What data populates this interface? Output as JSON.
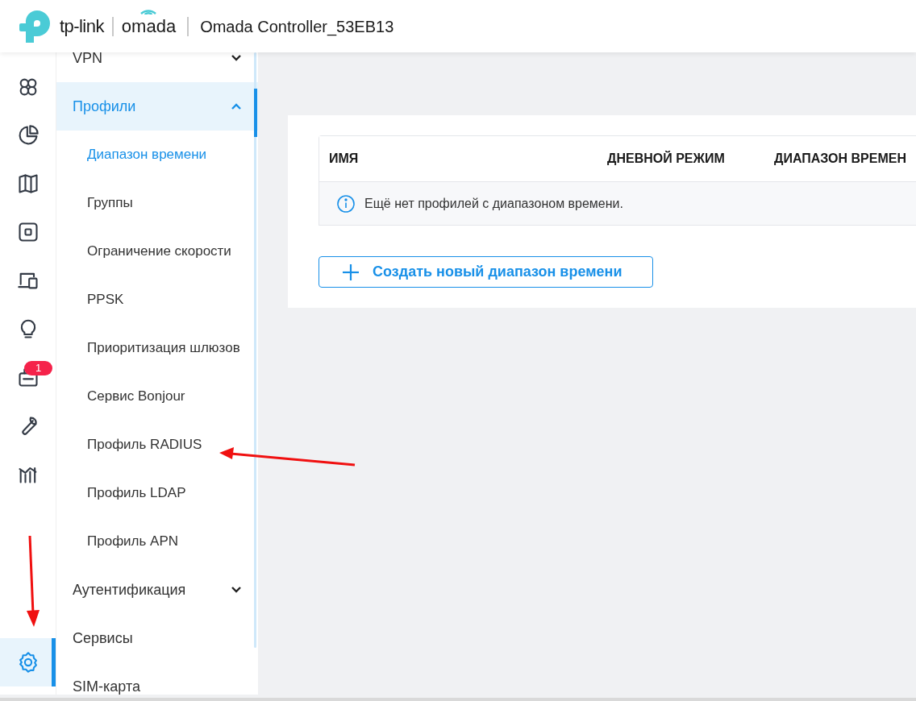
{
  "header": {
    "brand": "tp-link",
    "product": "omada",
    "title": "Omada Controller_53EB13"
  },
  "rail": [
    {
      "kind": "dashboard",
      "selected": false
    },
    {
      "kind": "statistics",
      "selected": false
    },
    {
      "kind": "map",
      "selected": false
    },
    {
      "kind": "devices",
      "selected": false
    },
    {
      "kind": "clients",
      "selected": false
    },
    {
      "kind": "insight",
      "selected": false
    },
    {
      "kind": "log",
      "selected": false,
      "badge": "1"
    },
    {
      "kind": "tools",
      "selected": false
    },
    {
      "kind": "reports",
      "selected": false
    },
    {
      "kind": "settings",
      "selected": true
    }
  ],
  "menu": [
    {
      "label": "VPN",
      "expanded": false,
      "selected": false
    },
    {
      "label": "Профили",
      "expanded": true,
      "selected": true,
      "children": [
        {
          "label": "Диапазон времени",
          "selected": true
        },
        {
          "label": "Группы",
          "selected": false
        },
        {
          "label": "Ограничение скорости",
          "selected": false
        },
        {
          "label": "PPSK",
          "selected": false
        },
        {
          "label": "Приоритизация шлюзов",
          "selected": false
        },
        {
          "label": "Сервис Bonjour",
          "selected": false
        },
        {
          "label": "Профиль RADIUS",
          "selected": false
        },
        {
          "label": "Профиль LDAP",
          "selected": false
        },
        {
          "label": "Профиль APN",
          "selected": false
        }
      ]
    },
    {
      "label": "Аутентификация",
      "expanded": false,
      "selected": false
    },
    {
      "label": "Сервисы",
      "selected": false
    },
    {
      "label": "SIM-карта",
      "selected": false
    }
  ],
  "table": {
    "columns": [
      "ИМЯ",
      "ДНЕВНОЙ РЕЖИМ",
      "ДИАПАЗОН ВРЕМЕН"
    ],
    "empty_message": "Ещё нет профилей с диапазоном времени."
  },
  "create_button": "Создать новый диапазон времени"
}
